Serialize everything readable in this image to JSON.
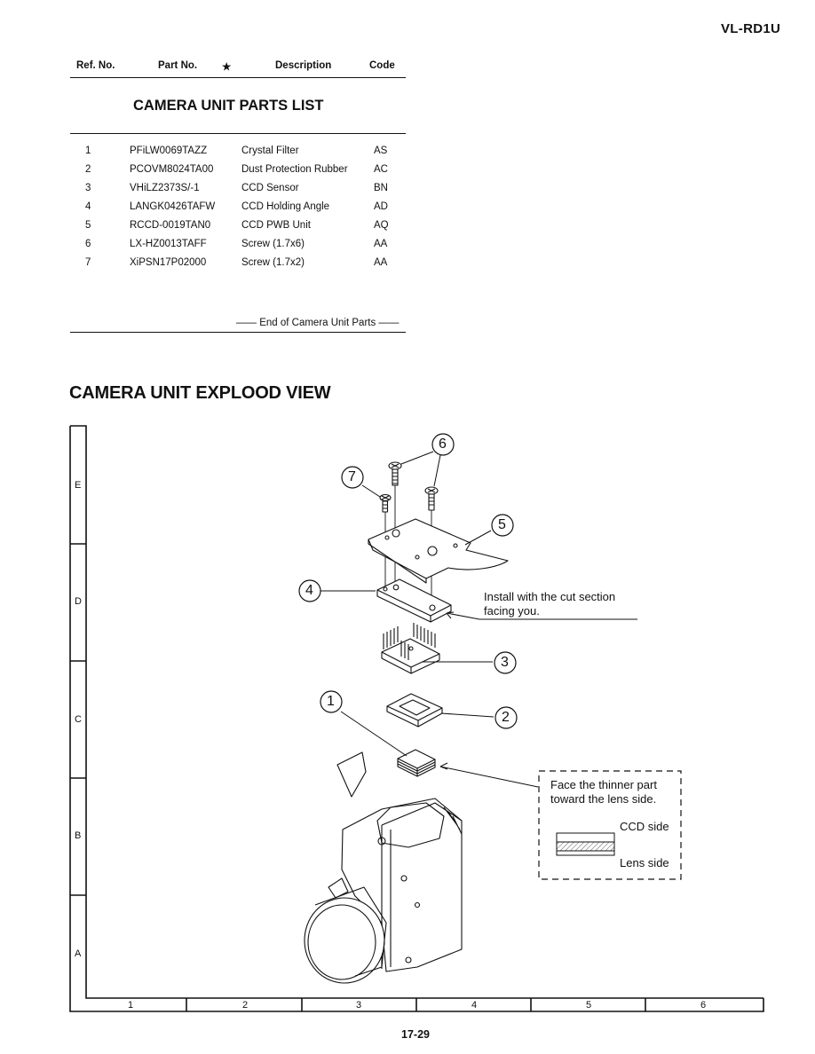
{
  "header": {
    "model": "VL-RD1U"
  },
  "parts_table": {
    "columns": {
      "ref": "Ref. No.",
      "part": "Part No.",
      "star": "★",
      "desc": "Description",
      "code": "Code"
    },
    "section_title": "CAMERA UNIT PARTS LIST",
    "rows": [
      {
        "ref": "1",
        "part": "PFiLW0069TAZZ",
        "desc": "Crystal Filter",
        "code": "AS"
      },
      {
        "ref": "2",
        "part": "PCOVM8024TA00",
        "desc": "Dust Protection Rubber",
        "code": "AC"
      },
      {
        "ref": "3",
        "part": "VHiLZ2373S/-1",
        "desc": "CCD Sensor",
        "code": "BN"
      },
      {
        "ref": "4",
        "part": "LANGK0426TAFW",
        "desc": "CCD Holding Angle",
        "code": "AD"
      },
      {
        "ref": "5",
        "part": "RCCD-0019TAN0",
        "desc": "CCD PWB Unit",
        "code": "AQ"
      },
      {
        "ref": "6",
        "part": "LX-HZ0013TAFF",
        "desc": "Screw (1.7x6)",
        "code": "AA"
      },
      {
        "ref": "7",
        "part": "XiPSN17P02000",
        "desc": "Screw (1.7x2)",
        "code": "AA"
      }
    ],
    "end_note": "—— End of Camera Unit Parts ——"
  },
  "exploded_view": {
    "title": "CAMERA UNIT EXPLOOD VIEW",
    "row_labels": [
      "E",
      "D",
      "C",
      "B",
      "A"
    ],
    "col_labels": [
      "1",
      "2",
      "3",
      "4",
      "5",
      "6"
    ],
    "callouts": [
      "1",
      "2",
      "3",
      "4",
      "5",
      "6",
      "7"
    ],
    "note_install_line1": "Install with the cut section",
    "note_install_line2": "facing you.",
    "note_filter_line1": "Face the thinner part",
    "note_filter_line2": "toward the lens side.",
    "ccd_side": "CCD side",
    "lens_side": "Lens side"
  },
  "footer": {
    "page": "17-29"
  }
}
